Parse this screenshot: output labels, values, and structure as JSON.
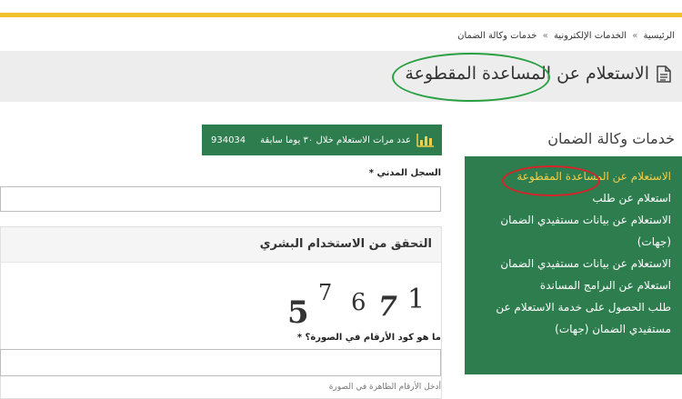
{
  "breadcrumb": [
    "الرئيسية",
    "الخدمات الإلكترونية",
    "خدمات وكالة الضمان"
  ],
  "breadcrumb_separator": "»",
  "page": {
    "title": "الاستعلام عن المساعدة المقطوعة",
    "title_icon": "document-icon"
  },
  "sidebar": {
    "heading": "خدمات وكالة الضمان",
    "items": [
      {
        "label": "الاستعلام عن المساعدة المقطوعة",
        "active": true
      },
      {
        "label": "استعلام عن طلب",
        "active": false
      },
      {
        "label": "الاستعلام عن بيانات مستفيدي الضمان",
        "active": false
      },
      {
        "label": "(جهات)",
        "active": false
      },
      {
        "label": "الاستعلام عن بيانات مستفيدي الضمان",
        "active": false
      },
      {
        "label": "استعلام عن البرامج المساندة",
        "active": false
      },
      {
        "label": "طلب الحصول على خدمة الاستعلام عن",
        "active": false
      },
      {
        "label": "مستفيدي الضمان (جهات)",
        "active": false
      }
    ]
  },
  "stats": {
    "label": "عدد مرات الاستعلام خلال ٣٠ يوما سابقة",
    "count": "934034",
    "icon": "bar-chart-icon"
  },
  "form": {
    "civil_label": "السجل المدني *",
    "civil_value": "",
    "verify_title": "التحقق من الاستخدام البشري",
    "captcha_digits": [
      "5",
      "7",
      "6",
      "7",
      "1"
    ],
    "captcha_question": "ما هو كود الأرقام في الصورة؟ *",
    "captcha_value": "",
    "hint": "أدخل الأرقام الظاهرة في الصورة"
  },
  "colors": {
    "brand_green": "#2e7d4f",
    "accent_yellow": "#f2c12e",
    "annotation_green": "#2aa043",
    "annotation_red": "#d8232a"
  }
}
